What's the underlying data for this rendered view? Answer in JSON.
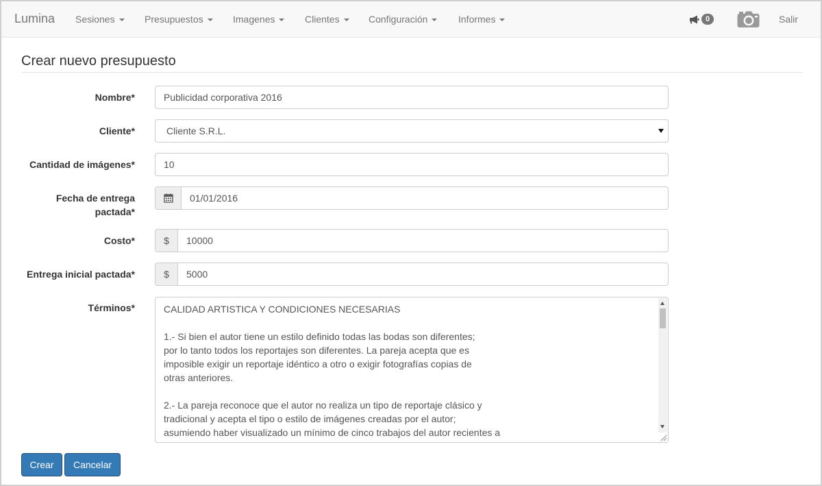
{
  "navbar": {
    "brand": "Lumina",
    "menus": [
      "Sesiones",
      "Presupuestos",
      "Imagenes",
      "Clientes",
      "Configuración",
      "Informes"
    ],
    "notifications_count": "0",
    "logout_label": "Salir",
    "icons": [
      "megaphone-icon",
      "camera-icon"
    ]
  },
  "page": {
    "title": "Crear nuevo presupuesto"
  },
  "form": {
    "nombre": {
      "label": "Nombre*",
      "value": "Publicidad corporativa 2016"
    },
    "cliente": {
      "label": "Cliente*",
      "value": "Cliente S.R.L."
    },
    "cantidad": {
      "label": "Cantidad de imágenes*",
      "value": "10"
    },
    "fecha": {
      "label_line1": "Fecha de entrega",
      "label_line2": "pactada*",
      "value": "01/01/2016"
    },
    "costo": {
      "label": "Costo*",
      "addon": "$",
      "value": "10000"
    },
    "entrega_inicial": {
      "label": "Entrega inicial pactada*",
      "addon": "$",
      "value": "5000"
    },
    "terminos": {
      "label": "Términos*",
      "value": "CALIDAD ARTISTICA Y CONDICIONES NECESARIAS\n\n1.- Si bien el autor tiene un estilo definido todas las bodas son diferentes;\npor lo tanto todos los reportajes son diferentes. La pareja acepta que es\nimposible exigir un reportaje idéntico a otro o exigir fotografías copias de\notras anteriores.\n\n2.- La pareja reconoce que el autor no realiza un tipo de reportaje clásico y\ntradicional y acepta el tipo o estilo de imágenes creadas por el autor;\nasumiendo haber visualizado un mínimo de cinco trabajos del autor recientes a\nla firma de este contrato publicados en su blog o en su sitio web."
    }
  },
  "actions": {
    "create_label": "Crear",
    "cancel_label": "Cancelar"
  },
  "colors": {
    "primary": "#337ab7",
    "navbar_bg": "#f8f8f8",
    "badge": "#777777"
  }
}
